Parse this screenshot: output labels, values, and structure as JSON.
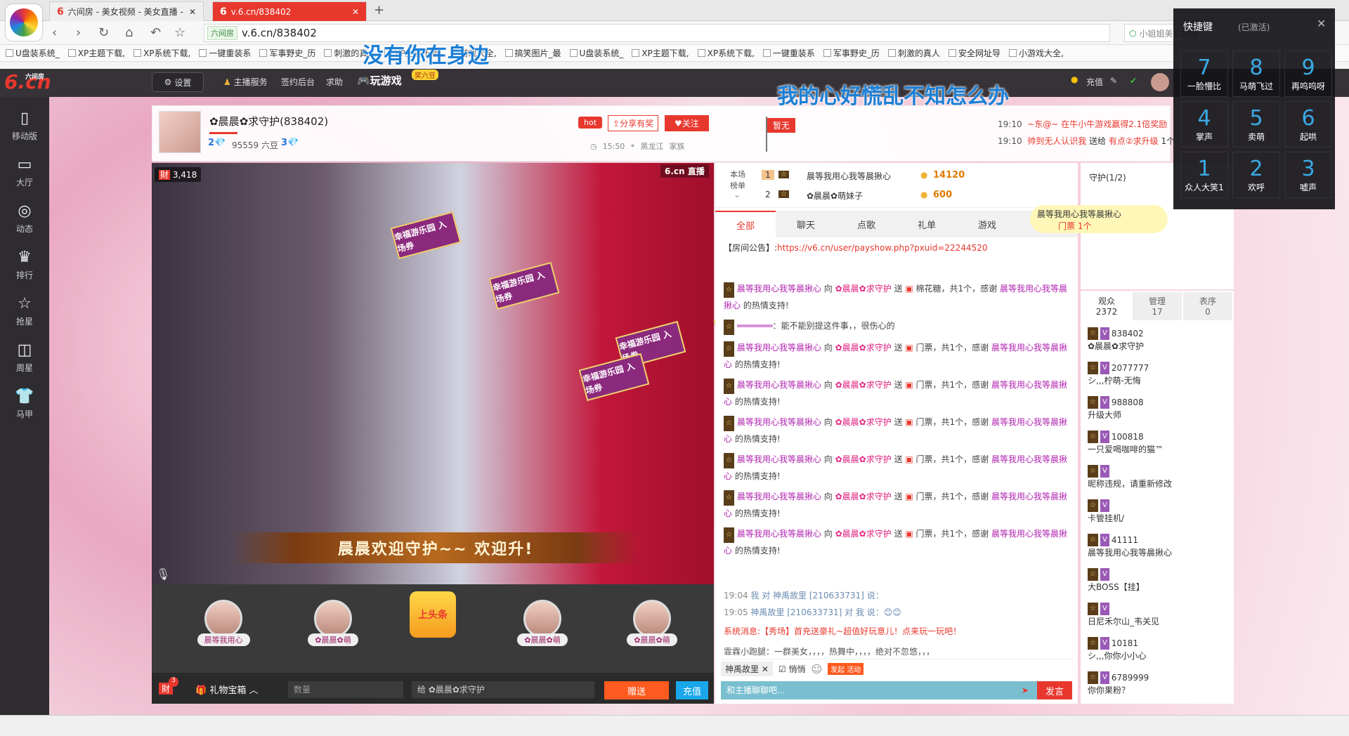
{
  "browser": {
    "tabs": [
      {
        "title": "六间房 - 美女视频 - 美女直播 -",
        "active": false
      },
      {
        "title": "v.6.cn/838402",
        "active": true
      }
    ],
    "site_badge": "六间房",
    "url": "v.6.cn/838402",
    "search_placeholder": "小姐姐美女直播",
    "bookmarks": [
      "U盘装系统_",
      "XP主题下载,",
      "XP系统下载,",
      "一键重装系",
      "军事野史_历",
      "刺激的真人",
      "XP主题下载,",
      "游戏大全,",
      "搞笑图片_最",
      "U盘装系统_",
      "XP主题下载,",
      "XP系统下载,",
      "一键重装系",
      "军事野史_历",
      "刺激的真人",
      "安全网址导",
      "小游戏大全,"
    ]
  },
  "lyrics": {
    "top": "没有你在身边",
    "bottom": "我的心好慌乱不知怎么办"
  },
  "site_nav": {
    "logo": "6.cn",
    "logo_sub": "六间房",
    "settings": "设置",
    "links": [
      "主播服务",
      "签约后台",
      "求助"
    ],
    "game_link": "玩游戏",
    "game_badge": "奖六豆",
    "recharge": "充值"
  },
  "sidebar": [
    {
      "label": "移动版",
      "icon": "mobile-icon"
    },
    {
      "label": "大厅",
      "icon": "tv-icon"
    },
    {
      "label": "动态",
      "icon": "compass-icon"
    },
    {
      "label": "排行",
      "icon": "crown-icon"
    },
    {
      "label": "抢星",
      "icon": "star-icon"
    },
    {
      "label": "周星",
      "icon": "bag-icon"
    },
    {
      "label": "马甲",
      "icon": "shirt-icon"
    }
  ],
  "room": {
    "name": "✿晨晨✿求守护(838402)",
    "level": "2💎",
    "beans": "95559 六豆",
    "level2": "3💎",
    "hot": "hot",
    "share": "分享有奖",
    "follow": "关注",
    "time": "15:50",
    "location": "黑龙江",
    "family": "家族",
    "flag": "暂无"
  },
  "notices": [
    {
      "time": "19:10",
      "a": "~东@~",
      "b": "在牛小牛游戏赢得2.1倍奖励"
    },
    {
      "time": "19:10",
      "a": "帅到无人认识我",
      "b": "送给",
      "c": "有点②求升级",
      "d": "1个"
    }
  ],
  "video": {
    "viewers": "3,418",
    "logo": "6.cn 直播",
    "banner": "晨晨欢迎守护~~ 欢迎升!",
    "ticket": "幸福游乐园 入场券"
  },
  "gift_slots": [
    "晨等我用心",
    "✿晨晨✿萌",
    "上头条",
    "✿晨晨✿萌",
    "✿晨晨✿萌"
  ],
  "bottom_bar": {
    "treasure": "礼物宝箱",
    "qty_placeholder": "数量",
    "to": "给 ✿晨晨✿求守护",
    "send": "赠送",
    "recharge": "充值",
    "treasure_count": "3"
  },
  "rank": {
    "label": "本场榜单",
    "rows": [
      {
        "rank": "1",
        "name": "晨等我用心我等晨揪心",
        "value": "14120"
      },
      {
        "rank": "2",
        "name": "✿晨晨✿萌妹子",
        "value": "600"
      }
    ]
  },
  "chat_tabs": [
    "全部",
    "聊天",
    "点歌",
    "礼单",
    "游戏"
  ],
  "room_notice": {
    "label": "【房间公告】:",
    "url": "https://v6.cn/user/payshow.php?pxuid=22244520"
  },
  "chat_messages": [
    {
      "user": "晨等我用心我等晨揪心",
      "to": "✿晨晨✿求守护",
      "gift": "棉花糖，共1个，感谢",
      "thanks": "晨等我用心我等晨揪心",
      "tail": "的热情支持!"
    },
    {
      "user": "═══════",
      "to": "",
      "gift": "能不能别提这件事，，很伤心的",
      "thanks": "",
      "tail": ""
    },
    {
      "user": "晨等我用心我等晨揪心",
      "to": "✿晨晨✿求守护",
      "gift": "门票，共1个，感谢",
      "thanks": "晨等我用心我等晨揪心",
      "tail": "的热情支持!"
    },
    {
      "user": "晨等我用心我等晨揪心",
      "to": "✿晨晨✿求守护",
      "gift": "门票，共1个，感谢",
      "thanks": "晨等我用心我等晨揪心",
      "tail": "的热情支持!"
    },
    {
      "user": "晨等我用心我等晨揪心",
      "to": "✿晨晨✿求守护",
      "gift": "门票，共1个，感谢",
      "thanks": "晨等我用心我等晨揪心",
      "tail": "的热情支持!"
    },
    {
      "user": "晨等我用心我等晨揪心",
      "to": "✿晨晨✿求守护",
      "gift": "门票，共1个，感谢",
      "thanks": "晨等我用心我等晨揪心",
      "tail": "的热情支持!"
    },
    {
      "user": "晨等我用心我等晨揪心",
      "to": "✿晨晨✿求守护",
      "gift": "门票，共1个，感谢",
      "thanks": "晨等我用心我等晨揪心",
      "tail": "的热情支持!"
    },
    {
      "user": "晨等我用心我等晨揪心",
      "to": "✿晨晨✿求守护",
      "gift": "门票，共1个，感谢",
      "thanks": "晨等我用心我等晨揪心",
      "tail": "的热情支持!"
    }
  ],
  "chat_lower": [
    {
      "time": "19:04",
      "text": "我 对 神禹故里 [210633731] 说："
    },
    {
      "time": "19:05",
      "text": "神禹故里 [210633731] 对 我 说：😊😊"
    }
  ],
  "system_msg": "系统消息:【秀场】首充送豪礼~超值好玩意儿！点来玩一玩吧！",
  "last_msg": "霏霖小跑腿：一群美女，，，，热舞中，，，，绝对不忽悠，，，",
  "chat_input": {
    "target": "神禹故里",
    "private_label": "悄悄",
    "placeholder": "和主播聊聊吧...",
    "send": "发言",
    "quick": "发起 活动"
  },
  "guard": {
    "title": "守护(1/2)",
    "float_name": "晨等我用心我等晨揪心",
    "float_text": "门票 1个"
  },
  "audience_tabs": [
    {
      "label": "观众",
      "count": "2372"
    },
    {
      "label": "管理",
      "count": "17"
    },
    {
      "label": "表序",
      "count": "0"
    }
  ],
  "audience": [
    {
      "id": "838402",
      "nick": "✿晨晨✿求守护"
    },
    {
      "id": "2077777",
      "nick": "シ,,,柠萌-无悔"
    },
    {
      "id": "988808",
      "nick": "升级大师"
    },
    {
      "id": "100818",
      "nick": "一只爱喝咖啡的猫™"
    },
    {
      "id": "",
      "nick": "昵称违规，请重新修改"
    },
    {
      "id": "",
      "nick": "卡管挂机/"
    },
    {
      "id": "41111",
      "nick": "晨等我用心我等晨揪心"
    },
    {
      "id": "",
      "nick": "大BOSS【挂】"
    },
    {
      "id": "",
      "nick": "日尼禾尔山_韦关见"
    },
    {
      "id": "10181",
      "nick": "シ,,,你你小小心"
    },
    {
      "id": "6789999",
      "nick": "你你果粉？"
    }
  ],
  "shortcut": {
    "title": "快捷键",
    "status": "(已激活)",
    "keys": [
      {
        "n": "7",
        "label": "一脸懵比"
      },
      {
        "n": "8",
        "label": "马萌飞过"
      },
      {
        "n": "9",
        "label": "再呜呜呀"
      },
      {
        "n": "4",
        "label": "掌声"
      },
      {
        "n": "5",
        "label": "卖萌"
      },
      {
        "n": "6",
        "label": "起哄"
      },
      {
        "n": "1",
        "label": "众人大笑1"
      },
      {
        "n": "2",
        "label": "欢呼"
      },
      {
        "n": "3",
        "label": "嘘声"
      }
    ]
  },
  "colors": {
    "accent": "#e8382e",
    "lyric": "#1b7fd6",
    "nav_bg": "#363238",
    "sidebar_bg": "#2f2c31"
  }
}
